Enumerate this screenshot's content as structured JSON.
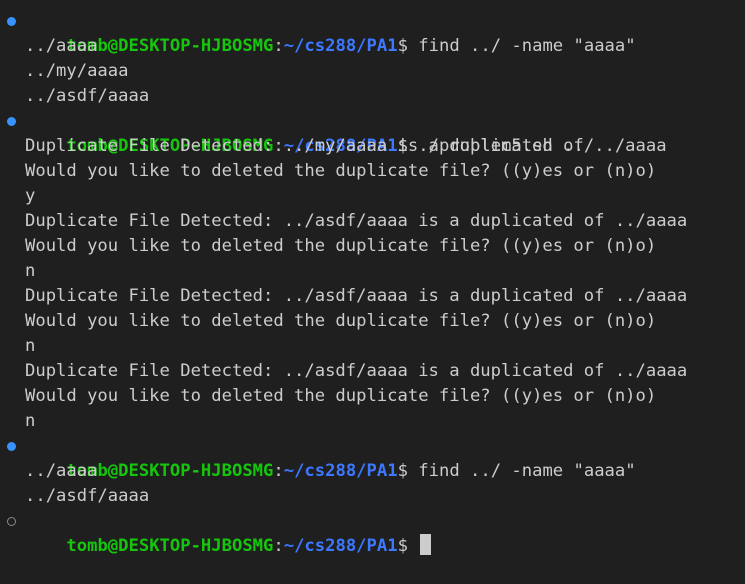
{
  "prompt": {
    "user_host": "tomb@DESKTOP-HJBOSMG",
    "separator": ":",
    "path": "~/cs288/PA1",
    "symbol": "$"
  },
  "commands": {
    "c1": "find ../ -name \"aaaa\"",
    "c2": "./problem5.sh ../",
    "c3": "find ../ -name \"aaaa\""
  },
  "output": {
    "find1": [
      "../aaaa",
      "../my/aaaa",
      "../asdf/aaaa"
    ],
    "dup": [
      "Duplicate File Detected: ../my/aaaa is a duplicated of ../aaaa",
      "Would you like to deleted the duplicate file? ((y)es or (n)o)",
      "y",
      "Duplicate File Detected: ../asdf/aaaa is a duplicated of ../aaaa",
      "Would you like to deleted the duplicate file? ((y)es or (n)o)",
      "n",
      "Duplicate File Detected: ../asdf/aaaa is a duplicated of ../aaaa",
      "Would you like to deleted the duplicate file? ((y)es or (n)o)",
      "n",
      "Duplicate File Detected: ../asdf/aaaa is a duplicated of ../aaaa",
      "Would you like to deleted the duplicate file? ((y)es or (n)o)",
      "n"
    ],
    "find2": [
      "../aaaa",
      "../asdf/aaaa"
    ]
  },
  "colors": {
    "background": "#1f1f1f",
    "text": "#cccccc",
    "user_host": "#16c60c",
    "path": "#3b78ff",
    "decoration_success": "#3794ff",
    "decoration_pending": "#8a8a8a"
  }
}
